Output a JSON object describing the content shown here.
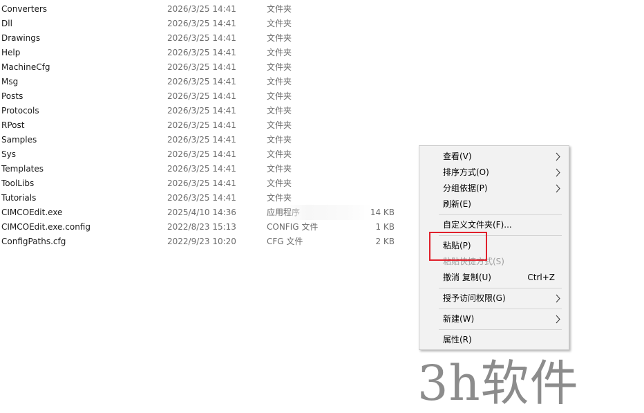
{
  "files": [
    {
      "name": "Converters",
      "date": "2026/3/25 14:41",
      "type": "文件夹",
      "size": ""
    },
    {
      "name": "Dll",
      "date": "2026/3/25 14:41",
      "type": "文件夹",
      "size": ""
    },
    {
      "name": "Drawings",
      "date": "2026/3/25 14:41",
      "type": "文件夹",
      "size": ""
    },
    {
      "name": "Help",
      "date": "2026/3/25 14:41",
      "type": "文件夹",
      "size": ""
    },
    {
      "name": "MachineCfg",
      "date": "2026/3/25 14:41",
      "type": "文件夹",
      "size": ""
    },
    {
      "name": "Msg",
      "date": "2026/3/25 14:41",
      "type": "文件夹",
      "size": ""
    },
    {
      "name": "Posts",
      "date": "2026/3/25 14:41",
      "type": "文件夹",
      "size": ""
    },
    {
      "name": "Protocols",
      "date": "2026/3/25 14:41",
      "type": "文件夹",
      "size": ""
    },
    {
      "name": "RPost",
      "date": "2026/3/25 14:41",
      "type": "文件夹",
      "size": ""
    },
    {
      "name": "Samples",
      "date": "2026/3/25 14:41",
      "type": "文件夹",
      "size": ""
    },
    {
      "name": "Sys",
      "date": "2026/3/25 14:41",
      "type": "文件夹",
      "size": ""
    },
    {
      "name": "Templates",
      "date": "2026/3/25 14:41",
      "type": "文件夹",
      "size": ""
    },
    {
      "name": "ToolLibs",
      "date": "2026/3/25 14:41",
      "type": "文件夹",
      "size": ""
    },
    {
      "name": "Tutorials",
      "date": "2026/3/25 14:41",
      "type": "文件夹",
      "size": ""
    },
    {
      "name": "CIMCOEdit.exe",
      "date": "2025/4/10 14:36",
      "type": "应用程序",
      "size": "14 KB"
    },
    {
      "name": "CIMCOEdit.exe.config",
      "date": "2022/8/23 15:13",
      "type": "CONFIG 文件",
      "size": "1 KB"
    },
    {
      "name": "ConfigPaths.cfg",
      "date": "2022/9/23 10:20",
      "type": "CFG 文件",
      "size": "2 KB"
    }
  ],
  "context_menu": {
    "view": {
      "label": "查看(V)"
    },
    "sort_by": {
      "label": "排序方式(O)"
    },
    "group_by": {
      "label": "分组依据(P)"
    },
    "refresh": {
      "label": "刷新(E)"
    },
    "customize_folder": {
      "label": "自定义文件夹(F)..."
    },
    "paste": {
      "label": "粘贴(P)"
    },
    "paste_shortcut": {
      "label": "粘贴快捷方式(S)"
    },
    "undo_copy": {
      "label": "撤消 复制(U)",
      "shortcut": "Ctrl+Z"
    },
    "give_access": {
      "label": "授予访问权限(G)"
    },
    "new": {
      "label": "新建(W)"
    },
    "properties": {
      "label": "属性(R)"
    }
  },
  "watermark": {
    "text": "3h软件"
  },
  "colors": {
    "highlight_border": "#e0202b",
    "menu_background": "#f2f2f2",
    "secondary_text": "#6d6d6d"
  }
}
